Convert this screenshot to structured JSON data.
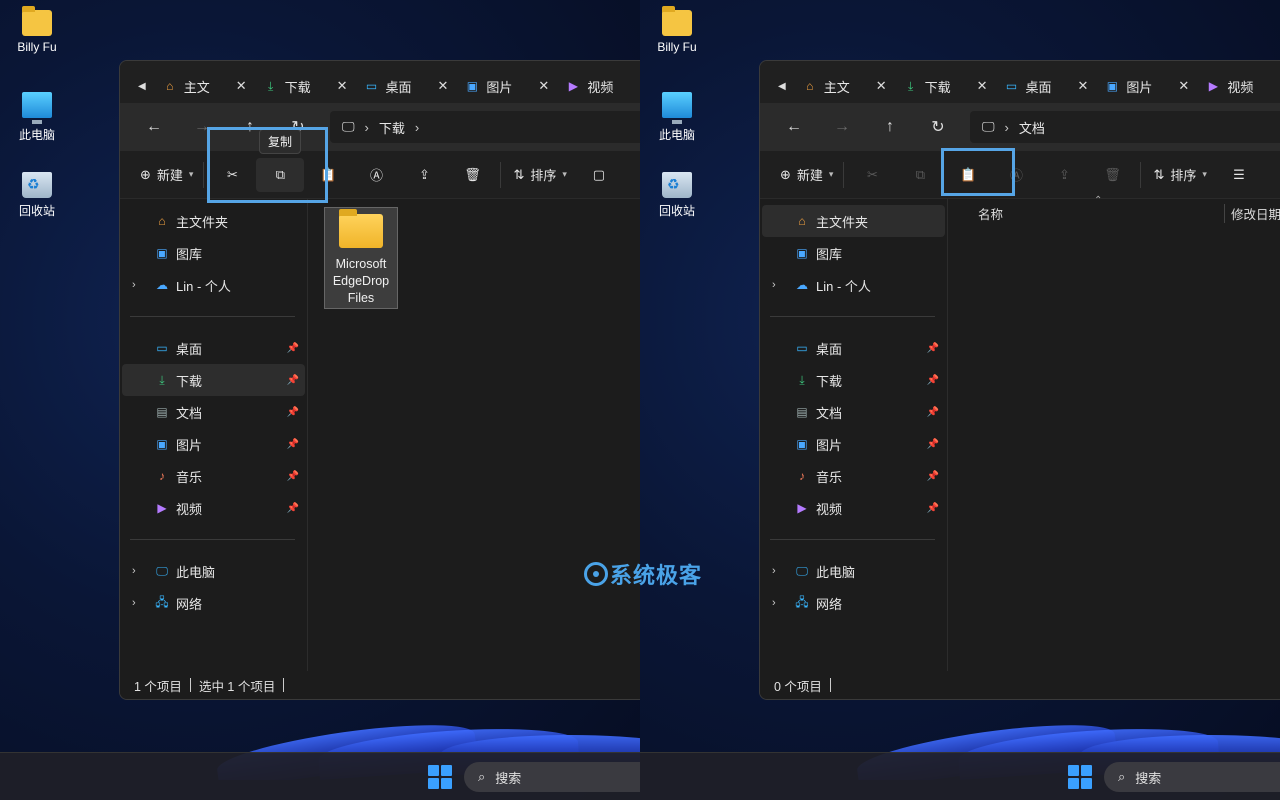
{
  "desktop": {
    "icons": [
      {
        "label": "Billy Fu",
        "icon": "folder-icon"
      },
      {
        "label": "此电脑",
        "icon": "computer-icon"
      },
      {
        "label": "回收站",
        "icon": "recycle-bin-icon"
      }
    ]
  },
  "tabs": [
    {
      "label": "主文",
      "icon": "home-icon"
    },
    {
      "label": "下载",
      "icon": "download-icon"
    },
    {
      "label": "桌面",
      "icon": "desktop-icon"
    },
    {
      "label": "图片",
      "icon": "pictures-icon"
    },
    {
      "label": "视频",
      "icon": "videos-icon"
    }
  ],
  "toolbar": {
    "new_label": "新建",
    "sort_label": "排序",
    "copy_tooltip": "复制"
  },
  "sidebar": {
    "top": [
      {
        "label": "主文件夹",
        "icon": "home-icon"
      },
      {
        "label": "图库",
        "icon": "gallery-icon"
      },
      {
        "label": "Lin - 个人",
        "icon": "onedrive-icon"
      }
    ],
    "pinned": [
      {
        "label": "桌面",
        "icon": "desktop-icon"
      },
      {
        "label": "下载",
        "icon": "download-icon"
      },
      {
        "label": "文档",
        "icon": "documents-icon"
      },
      {
        "label": "图片",
        "icon": "pictures-icon"
      },
      {
        "label": "音乐",
        "icon": "music-icon"
      },
      {
        "label": "视频",
        "icon": "videos-icon"
      }
    ],
    "bottom": [
      {
        "label": "此电脑",
        "icon": "computer-icon"
      },
      {
        "label": "网络",
        "icon": "network-icon"
      }
    ]
  },
  "left_window": {
    "breadcrumb": "下载",
    "file": {
      "name_line1": "Microsoft",
      "name_line2": "EdgeDrop",
      "name_line3": "Files"
    },
    "status_count": "1 个项目",
    "status_selected": "选中 1 个项目"
  },
  "right_window": {
    "breadcrumb": "文档",
    "col_name": "名称",
    "col_date": "修改日期",
    "status_count": "0 个项目"
  },
  "taskbar": {
    "search_label": "搜索"
  },
  "watermark": "系统极客",
  "colors": {
    "highlight": "#56a5e6",
    "accent": "#3aa0ff"
  }
}
